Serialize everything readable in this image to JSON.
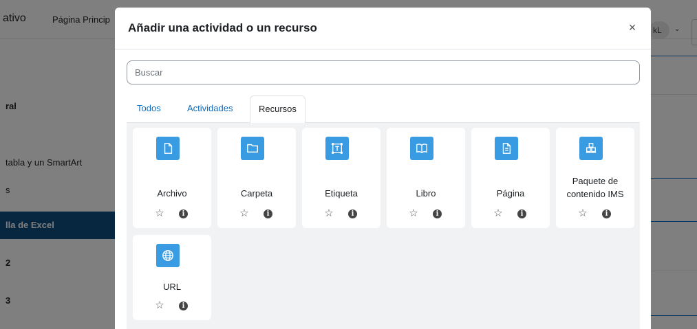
{
  "background": {
    "brand": "ativo",
    "nav_link": "Página Princip",
    "user_initials": "kL",
    "user_chevron": "⌄",
    "sidebar": {
      "items": [
        {
          "label": "ral",
          "bold": true
        },
        {
          "label": "tabla y un SmartArt",
          "bold": false
        },
        {
          "label": "s",
          "bold": false
        },
        {
          "label": "2",
          "bold": true
        },
        {
          "label": "3",
          "bold": true
        }
      ],
      "active_label": "lla de Excel"
    }
  },
  "modal": {
    "title": "Añadir una actividad o un recurso",
    "close_label": "×",
    "search": {
      "placeholder": "Buscar",
      "value": ""
    },
    "tabs": [
      {
        "label": "Todos",
        "active": false
      },
      {
        "label": "Actividades",
        "active": false
      },
      {
        "label": "Recursos",
        "active": true
      }
    ],
    "items": [
      {
        "name": "Archivo",
        "icon": "file-icon"
      },
      {
        "name": "Carpeta",
        "icon": "folder-icon"
      },
      {
        "name": "Etiqueta",
        "icon": "label-text-icon"
      },
      {
        "name": "Libro",
        "icon": "book-icon"
      },
      {
        "name": "Página",
        "icon": "page-icon"
      },
      {
        "name": "Paquete de contenido IMS",
        "icon": "boxes-icon"
      },
      {
        "name": "URL",
        "icon": "globe-icon"
      }
    ],
    "star_glyph": "☆",
    "info_glyph": "i"
  },
  "colors": {
    "accent": "#0f6cbf",
    "icon_bg": "#399be2",
    "panel_bg": "#f1f2f4",
    "active_sidebar": "#0f4c81"
  }
}
